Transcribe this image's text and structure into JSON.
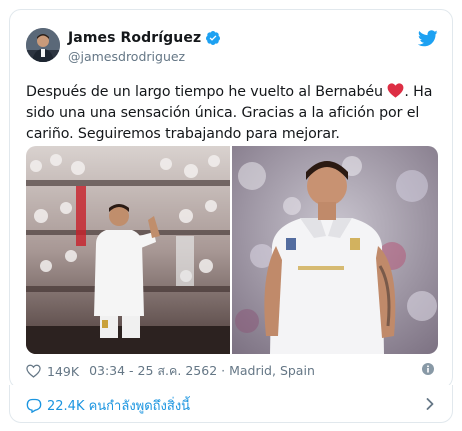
{
  "tweet": {
    "display_name": "James Rodríguez",
    "handle": "@jamesdrodriguez",
    "text_part1": "Después de un largo tiempo he vuelto al Bernabéu ",
    "text_part2": ". Ha sido una una sensación única. Gracias a la afición por el cariño. Seguiremos trabajando para mejorar.",
    "emoji": "red-heart",
    "verified": true,
    "likes": "149K",
    "timestamp": "03:34 - 25 ส.ค. 2562 · Madrid, Spain"
  },
  "conversation": {
    "label": "22.4K คนกำลังพูดถึงสิ่งนี้"
  },
  "colors": {
    "twitter_blue": "#1da1f2",
    "link_blue": "#1b95e0",
    "muted": "#657786",
    "border": "#e1e8ed",
    "heart_red": "#e0245e"
  },
  "icons": [
    "twitter-bird-icon",
    "verified-badge-icon",
    "heart-outline-icon",
    "info-icon",
    "comment-icon",
    "chevron-right-icon"
  ]
}
